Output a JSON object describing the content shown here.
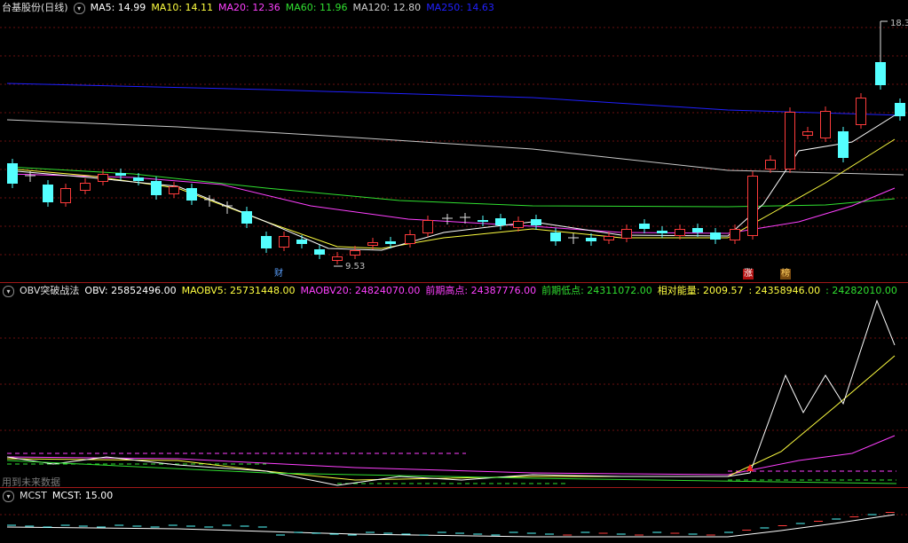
{
  "main": {
    "title": "台基股份(日线)",
    "ma": [
      {
        "label": "MA5: 14.99",
        "color": "#ffffff"
      },
      {
        "label": "MA10: 14.11",
        "color": "#ffff40"
      },
      {
        "label": "MA20: 12.36",
        "color": "#ff40ff"
      },
      {
        "label": "MA60: 11.96",
        "color": "#30e030"
      },
      {
        "label": "MA120: 12.80",
        "color": "#d0d0d0"
      },
      {
        "label": "MA250: 14.63",
        "color": "#2020ff"
      }
    ],
    "high_label": "18.3",
    "low_label": "9.53",
    "markers": [
      {
        "text": "财",
        "color": "#5aa0ff",
        "bg": "transparent"
      },
      {
        "text": "涨",
        "color": "#ffffff",
        "bg": "#b01010"
      },
      {
        "text": "榜",
        "color": "#ffd060",
        "bg": "#7a4a10"
      }
    ]
  },
  "obv": {
    "title": "OBV突破战法",
    "items": [
      {
        "label": "OBV: 25852496.00",
        "color": "#ffffff"
      },
      {
        "label": "MAOBV5: 25731448.00",
        "color": "#ffff40"
      },
      {
        "label": "MAOBV20: 24824070.00",
        "color": "#ff40ff"
      },
      {
        "label": "前期高点: 24387776.00",
        "color": "#ff40ff"
      },
      {
        "label": "前期低点: 24311072.00",
        "color": "#30e030"
      },
      {
        "label": "相对能量: 2009.57",
        "color": "#ffff40"
      },
      {
        "label": ": 24358946.00",
        "color": "#ffff40"
      },
      {
        "label": ": 24282010.00",
        "color": "#30e030"
      }
    ],
    "footnote": "用到未来数据"
  },
  "mcst": {
    "title": "MCST",
    "items": [
      {
        "label": "MCST: 15.00",
        "color": "#ffffff"
      }
    ]
  }
}
